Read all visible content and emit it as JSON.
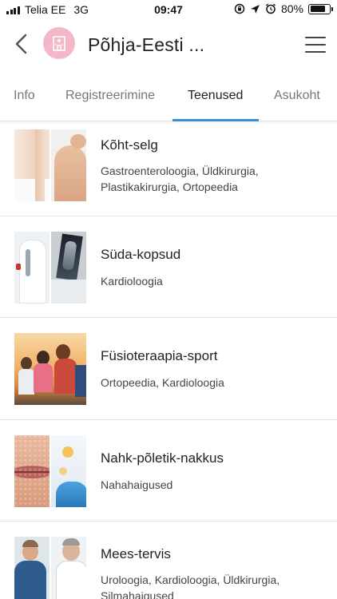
{
  "status_bar": {
    "carrier": "Telia EE",
    "network": "3G",
    "time": "09:47",
    "battery": "80%",
    "battery_level": 0.8
  },
  "header": {
    "title": "Põhja-Eesti ...",
    "logo_color": "#f3b8c8"
  },
  "tabs": [
    {
      "label": "Info",
      "active": false
    },
    {
      "label": "Registreerimine",
      "active": false
    },
    {
      "label": "Teenused",
      "active": true
    },
    {
      "label": "Asukoht",
      "active": false
    }
  ],
  "accent_color": "#3a8fd6",
  "services": [
    {
      "title": "Kõht-selg",
      "subtitle": "Gastroenteroloogia, Üldkirurgia, Plastikakirurgia, Ortopeedia"
    },
    {
      "title": "Süda-kopsud",
      "subtitle": "Kardioloogia"
    },
    {
      "title": "Füsioteraapia-sport",
      "subtitle": "Ortopeedia, Kardioloogia"
    },
    {
      "title": "Nahk-põletik-nakkus",
      "subtitle": "Nahahaigused"
    },
    {
      "title": "Mees-tervis",
      "subtitle": "Uroloogia, Kardioloogia, Üldkirurgia, Silmahaigused"
    }
  ]
}
